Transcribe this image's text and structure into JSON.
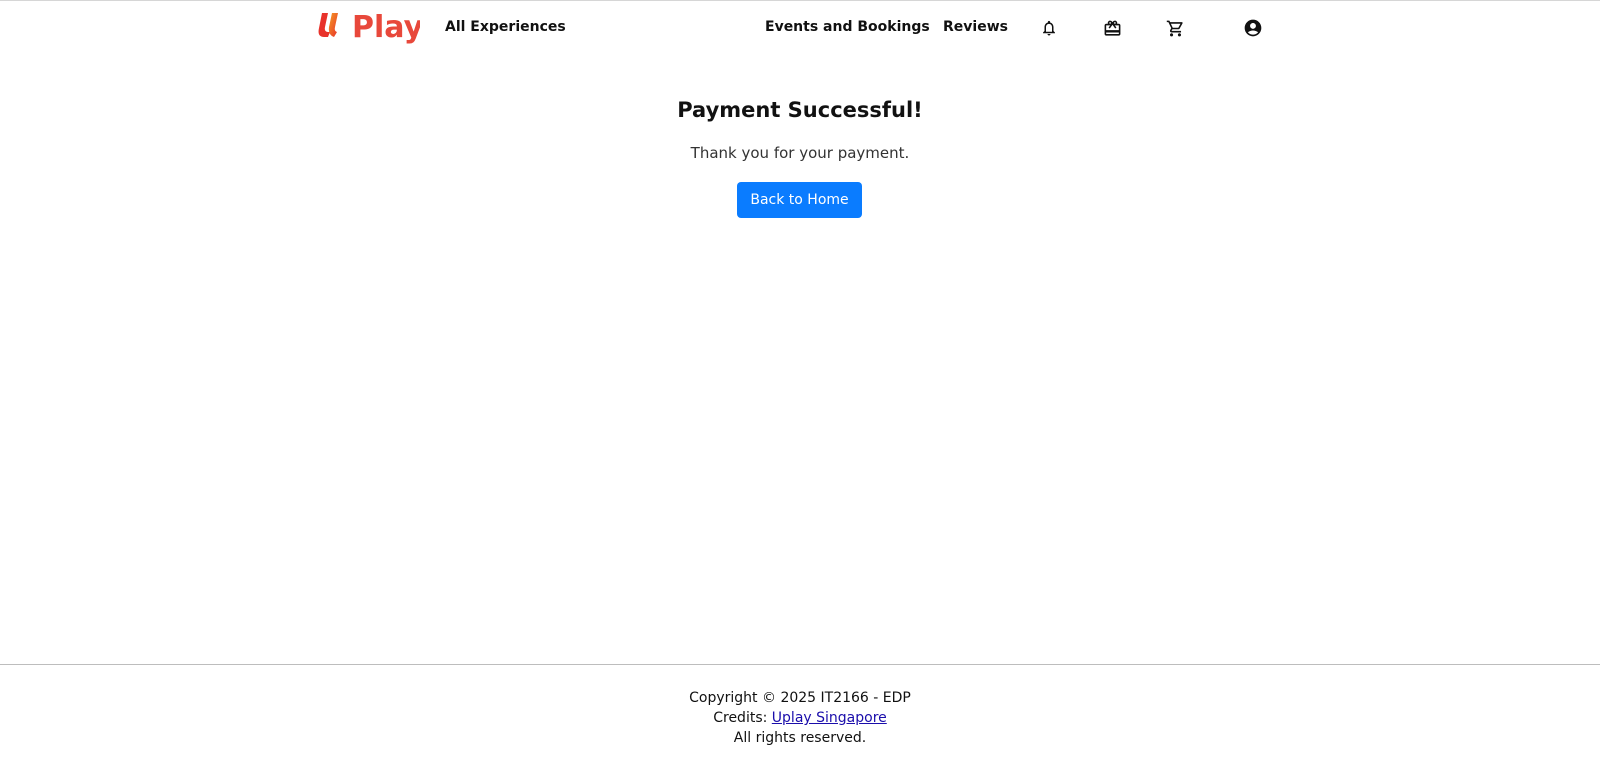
{
  "brand": {
    "logo_text": "Play",
    "logo_mark": "U",
    "logo_colors": [
      "#e8322b",
      "#f59a23"
    ]
  },
  "nav": {
    "all_experiences": "All Experiences",
    "events_and_bookings": "Events and Bookings",
    "reviews": "Reviews",
    "icons": [
      "bell-icon",
      "gift-icon",
      "cart-icon",
      "account-icon"
    ]
  },
  "main": {
    "title": "Payment Successful!",
    "message": "Thank you for your payment.",
    "back_button_label": "Back to Home",
    "button_color": "#0a7cff"
  },
  "footer": {
    "copyright": "Copyright © 2025 IT2166 - EDP",
    "credits_label": "Credits:",
    "credits_link": "Uplay Singapore",
    "rights": "All rights reserved."
  }
}
